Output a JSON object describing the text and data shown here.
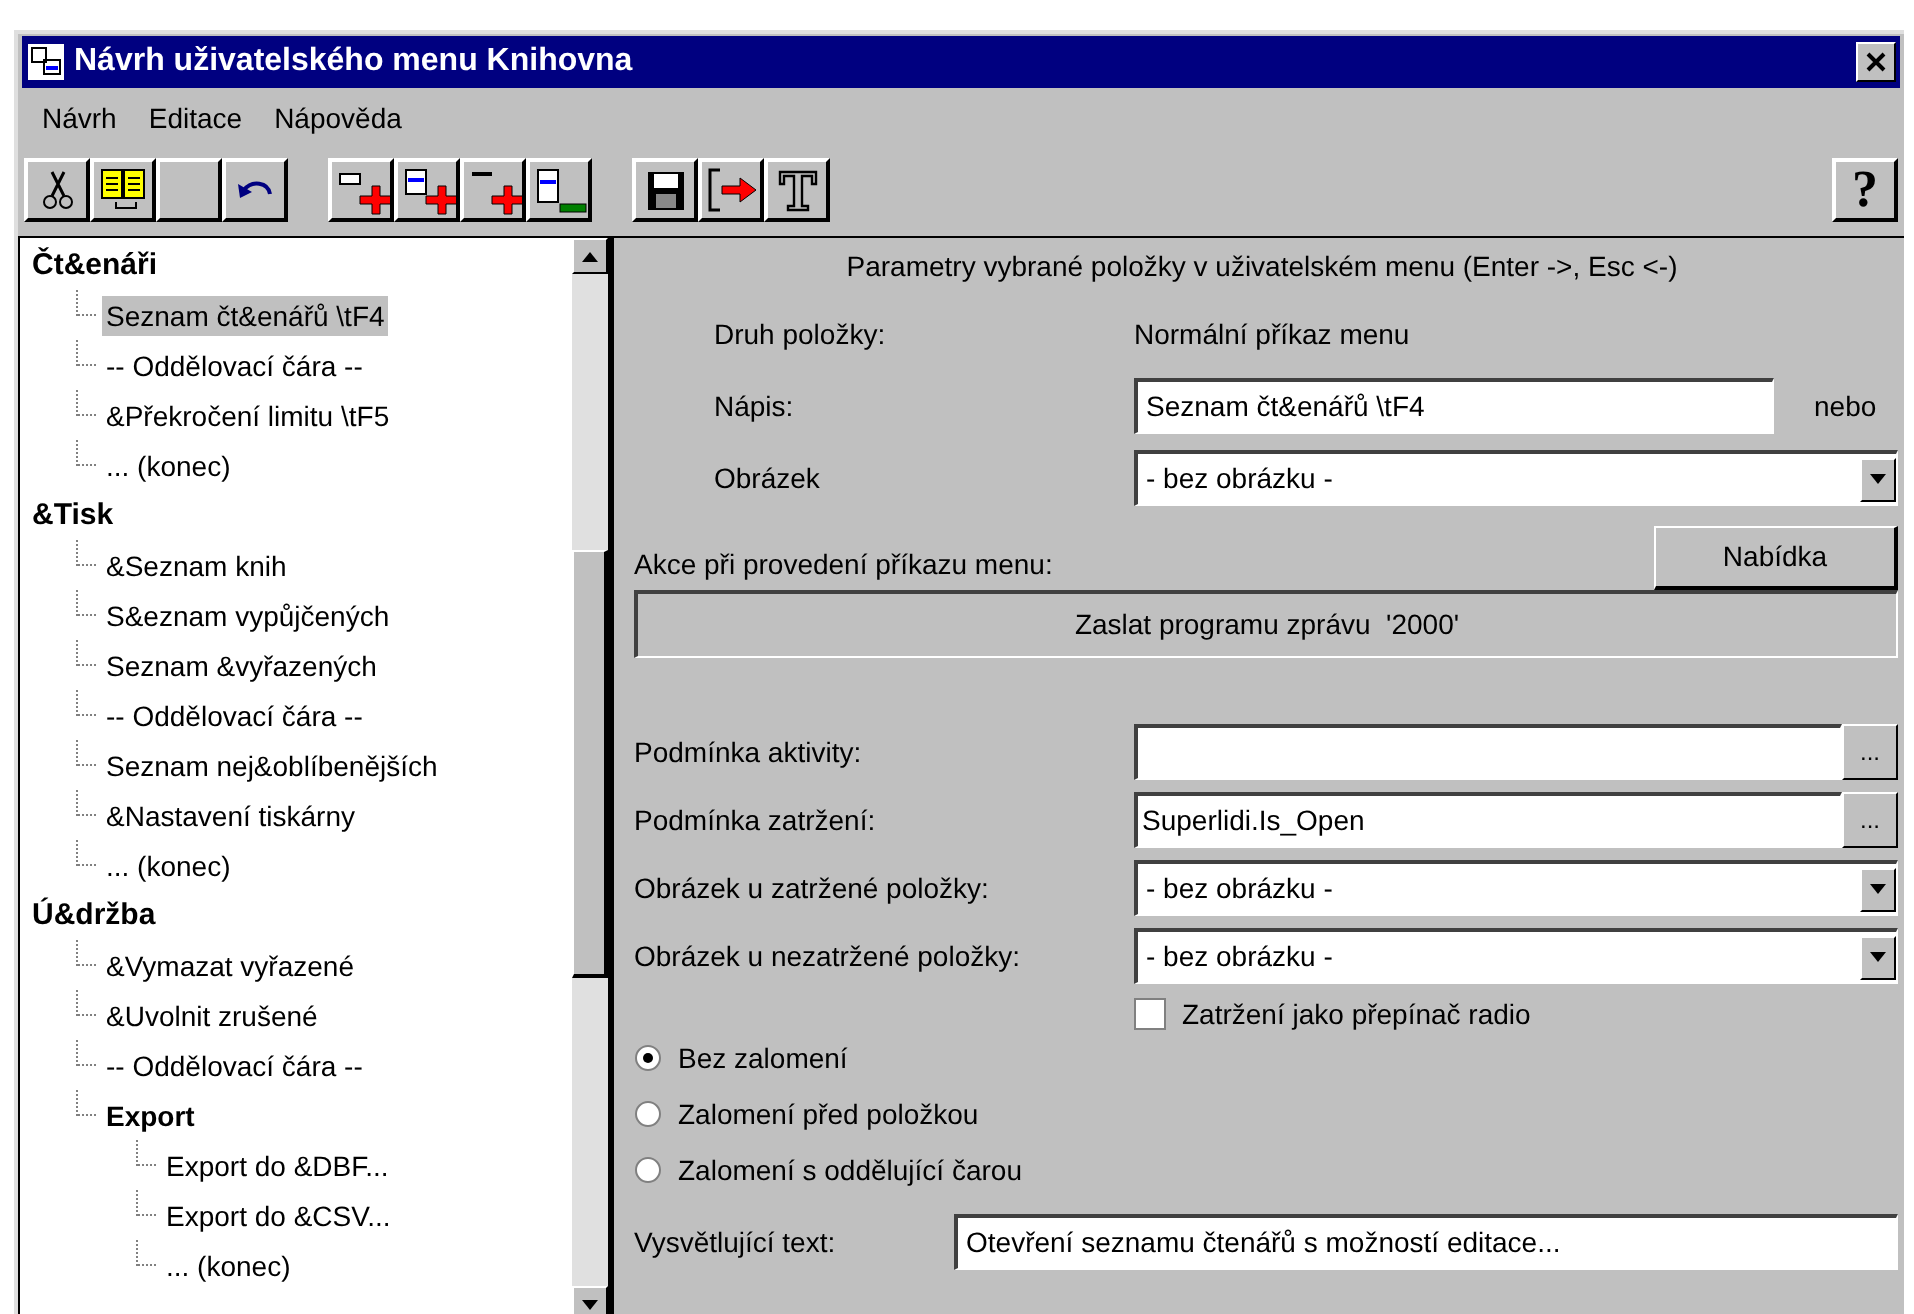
{
  "window": {
    "title": "Návrh uživatelského menu Knihovna"
  },
  "menu": [
    {
      "label": "Návrh"
    },
    {
      "label": "Editace"
    },
    {
      "label": "Nápověda"
    }
  ],
  "toolbar": {
    "help": "?"
  },
  "tree": [
    {
      "label": "Čt&enáři",
      "selected": false,
      "children": [
        {
          "label": "Seznam čt&enářů \\tF4",
          "selected": true
        },
        {
          "label": "-- Oddělovací čára --",
          "selected": false
        },
        {
          "label": "&Překročení limitu \\tF5",
          "selected": false
        },
        {
          "label": "... (konec)",
          "selected": false
        }
      ]
    },
    {
      "label": "&Tisk",
      "selected": false,
      "children": [
        {
          "label": "&Seznam knih",
          "selected": false
        },
        {
          "label": "S&eznam vypůjčených",
          "selected": false
        },
        {
          "label": "Seznam &vyřazených",
          "selected": false
        },
        {
          "label": "-- Oddělovací čára --",
          "selected": false
        },
        {
          "label": "Seznam nej&oblíbenějších",
          "selected": false
        },
        {
          "label": "&Nastavení tiskárny",
          "selected": false
        },
        {
          "label": "... (konec)",
          "selected": false
        }
      ]
    },
    {
      "label": "Ú&držba",
      "selected": false,
      "children": [
        {
          "label": "&Vymazat vyřazené",
          "selected": false
        },
        {
          "label": "&Uvolnit zrušené",
          "selected": false
        },
        {
          "label": "-- Oddělovací čára --",
          "selected": false
        },
        {
          "label": "Export",
          "selected": false,
          "children": [
            {
              "label": "Export do &DBF...",
              "selected": false
            },
            {
              "label": "Export do &CSV...",
              "selected": false
            },
            {
              "label": "... (konec)",
              "selected": false
            }
          ]
        }
      ]
    }
  ],
  "panel": {
    "heading": "Parametry vybrané položky v uživatelském menu (Enter ->, Esc <-)",
    "fields": [
      {
        "kind": "static",
        "label": "Druh položky:",
        "value": "Normální příkaz menu"
      },
      {
        "kind": "text",
        "label": "Nápis:",
        "value": "Seznam čt&enářů \\tF4",
        "suffix": "nebo"
      },
      {
        "kind": "dropdown",
        "label": "Obrázek",
        "value": "- bez obrázku -"
      }
    ],
    "action": {
      "label": "Akce při provedení příkazu menu:",
      "button": "Nabídka",
      "value": "Zaslat programu zprávu  '2000'"
    },
    "conditions": [
      {
        "kind": "ellipsis",
        "label": "Podmínka aktivity:",
        "button": "..."
      },
      {
        "kind": "ellipsis",
        "label": "Podmínka zatržení:",
        "value": "Superlidi.Is_Open",
        "button": "..."
      },
      {
        "kind": "dropdown",
        "label": "Obrázek u zatržené položky:",
        "value": "- bez obrázku -"
      },
      {
        "kind": "dropdown",
        "label": "Obrázek u nezatržené položky:",
        "value": "- bez obrázku -"
      }
    ],
    "checkbox": {
      "label": "Zatržení jako přepínač radio",
      "checked": false
    },
    "radios": [
      {
        "label": "Bez zalomení",
        "selected": true
      },
      {
        "label": "Zalomení před položkou",
        "selected": false
      },
      {
        "label": "Zalomení s oddělující čarou",
        "selected": false
      }
    ],
    "hint": {
      "label": "Vysvětlující text:",
      "value": "Otevření seznamu čtenářů s možností editace..."
    }
  }
}
